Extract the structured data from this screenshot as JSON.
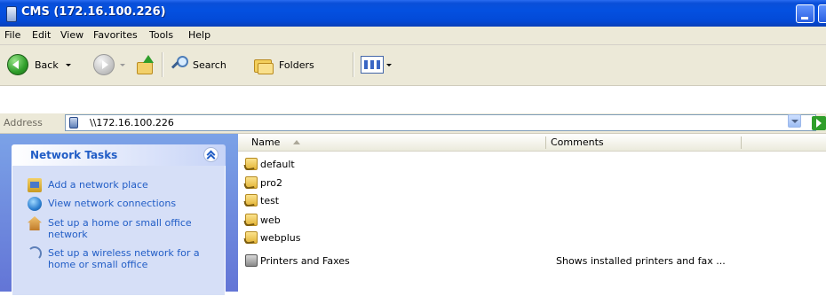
{
  "window": {
    "title": "CMS (172.16.100.226)"
  },
  "menu": [
    "File",
    "Edit",
    "View",
    "Favorites",
    "Tools",
    "Help"
  ],
  "toolbar": {
    "back_label": "Back",
    "search_label": "Search",
    "folders_label": "Folders"
  },
  "address": {
    "label": "Address",
    "value": "\\\\172.16.100.226"
  },
  "tasks": {
    "header": "Network Tasks",
    "items": [
      {
        "label": "Add a network place",
        "icon": "network-place-icon"
      },
      {
        "label": "View network connections",
        "icon": "network-connections-icon"
      },
      {
        "label": "Set up a home or small office network",
        "icon": "home-network-icon"
      },
      {
        "label": "Set up a wireless network for a home or small office",
        "icon": "wireless-network-icon"
      }
    ]
  },
  "columns": {
    "name": "Name",
    "comments": "Comments"
  },
  "files": [
    {
      "name": "default",
      "comment": "",
      "icon": "shared-folder-icon"
    },
    {
      "name": "pro2",
      "comment": "",
      "icon": "shared-folder-icon"
    },
    {
      "name": "test",
      "comment": "",
      "icon": "shared-folder-icon"
    },
    {
      "name": "web",
      "comment": "",
      "icon": "shared-folder-icon"
    },
    {
      "name": "webplus",
      "comment": "",
      "icon": "shared-folder-icon"
    },
    {
      "name": "Printers and Faxes",
      "comment": "Shows installed printers and fax ...",
      "icon": "printer-icon"
    }
  ]
}
